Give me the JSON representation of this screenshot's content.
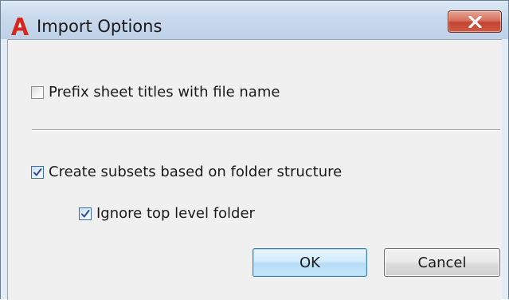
{
  "window": {
    "title": "Import Options",
    "app_icon": "autodesk-a-icon",
    "close_icon": "close-icon"
  },
  "options": {
    "prefix_titles": {
      "label": "Prefix sheet titles with file name",
      "checked": false
    },
    "create_subsets": {
      "label": "Create subsets based on folder structure",
      "checked": true
    },
    "ignore_top_level": {
      "label": "Ignore top level folder",
      "checked": true
    }
  },
  "buttons": {
    "ok_label": "OK",
    "cancel_label": "Cancel"
  },
  "colors": {
    "app_icon_red": "#d32a1f",
    "close_button_red": "#c44431",
    "checkmark_blue": "#2a4d8c",
    "ok_button_border": "#3c7fb1"
  }
}
